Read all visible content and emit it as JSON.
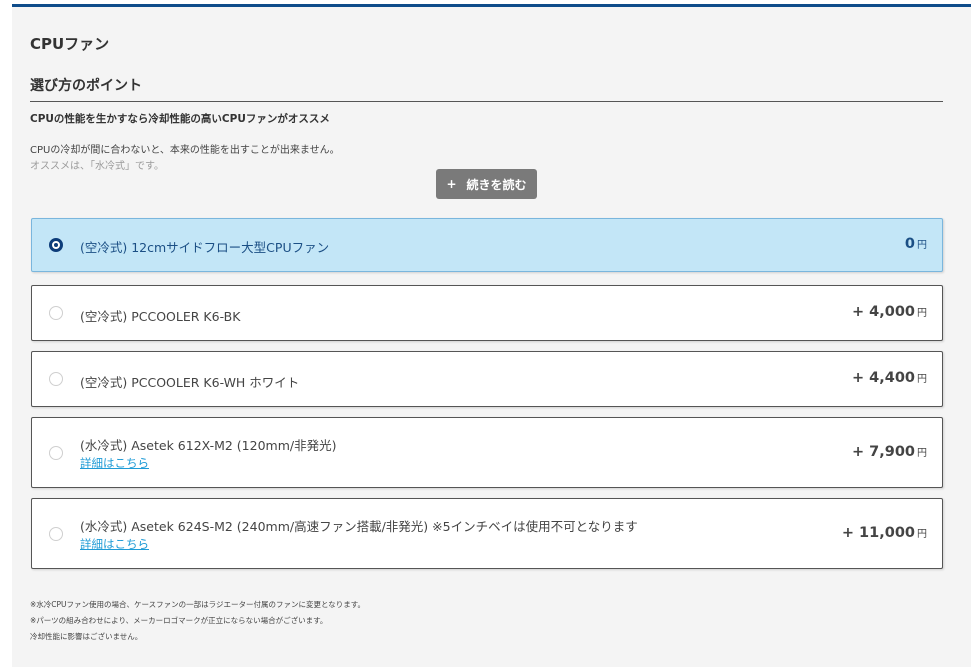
{
  "section": {
    "title": "CPUファン"
  },
  "points": {
    "title": "選び方のポイント",
    "heading": "CPUの性能を生かすなら冷却性能の高いCPUファンがオススメ",
    "body_line_1": "CPUの冷却が間に合わないと、本来の性能を出すことが出来ません。",
    "body_line_2": "オススメは、「水冷式」です。",
    "read_more_icon": "+",
    "read_more_label": "続きを読む"
  },
  "options": [
    {
      "label": "(空冷式) 12cmサイドフロー大型CPUファン",
      "price": "0",
      "unit": "円",
      "selected": true
    },
    {
      "label": "(空冷式) PCCOOLER K6-BK",
      "price": "+ 4,000",
      "unit": "円",
      "selected": false
    },
    {
      "label": "(空冷式) PCCOOLER K6-WH ホワイト",
      "price": "+ 4,400",
      "unit": "円",
      "selected": false
    },
    {
      "label": "(水冷式) Asetek 612X-M2 (120mm/非発光)",
      "link": "詳細はこちら",
      "price": "+ 7,900",
      "unit": "円",
      "selected": false
    },
    {
      "label": "(水冷式) Asetek 624S-M2 (240mm/高速ファン搭載/非発光) ※5インチベイは使用不可となります",
      "link": "詳細はこちら",
      "price": "+ 11,000",
      "unit": "円",
      "selected": false
    }
  ],
  "notes": [
    "※水冷CPUファン使用の場合、ケースファンの一部はラジエーター付属のファンに変更となります。",
    "※パーツの組み合わせにより、メーカーロゴマークが正立にならない場合がございます。",
    "冷却性能に影響はございません。"
  ],
  "colors": {
    "accent_bar": "#0f4c8a",
    "selected_bg": "#c3e6f7",
    "link": "#1f9bd6",
    "button_bg": "#7a7a7a"
  },
  "icons": {
    "radio_selected": "radio-selected-icon",
    "radio_empty": "radio-empty-icon",
    "plus": "plus-icon"
  }
}
